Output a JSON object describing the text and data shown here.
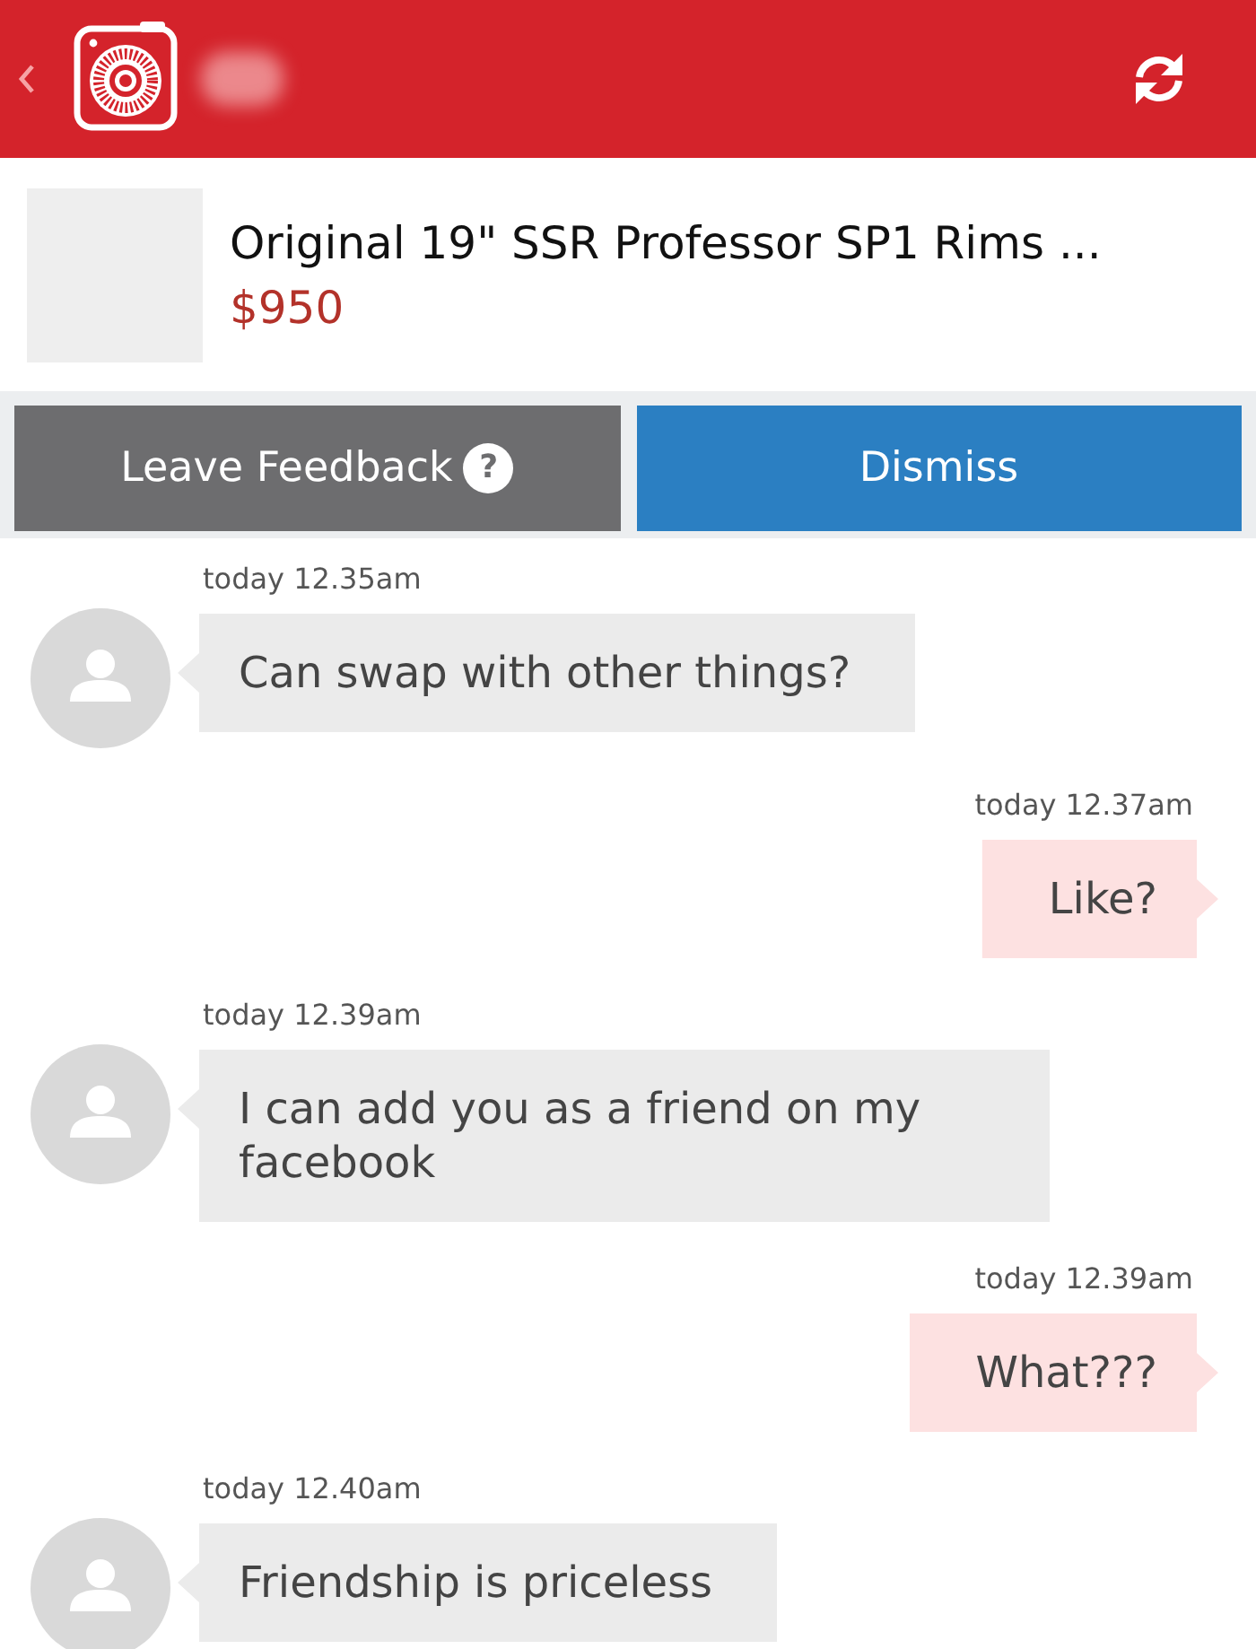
{
  "listing": {
    "title": "Original 19\" SSR Professor SP1 Rims ...",
    "price": "$950"
  },
  "actions": [
    {
      "kind": "feedback",
      "label": "Leave Feedback",
      "badge": "?"
    },
    {
      "kind": "dismiss",
      "label": "Dismiss"
    }
  ],
  "messages": [
    {
      "kind": "received",
      "time": "today 12.35am",
      "text": "Can swap with other things?"
    },
    {
      "kind": "sent",
      "time": "today 12.37am",
      "text": "Like?"
    },
    {
      "kind": "received",
      "time": "today 12.39am",
      "text": "I can add you as a friend on my facebook"
    },
    {
      "kind": "sent",
      "time": "today 12.39am",
      "text": "What???"
    },
    {
      "kind": "received",
      "time": "today 12.40am",
      "text": "Friendship is priceless"
    }
  ]
}
